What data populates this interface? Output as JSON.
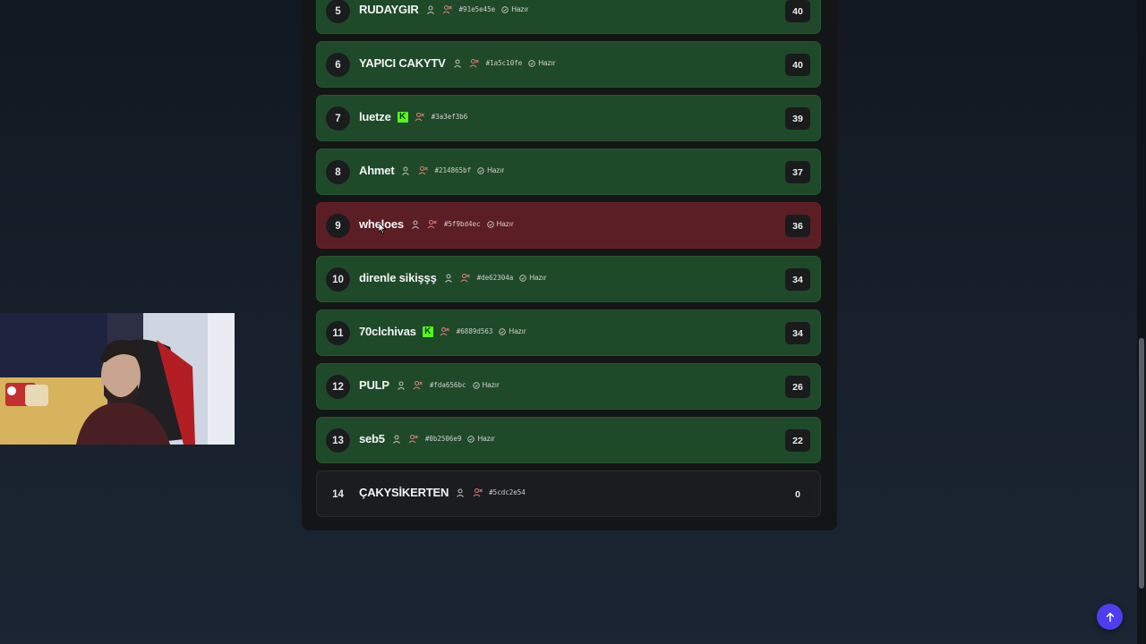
{
  "leaderboard": {
    "rows": [
      {
        "rank": "5",
        "name": "RUDAYGIR",
        "kick": false,
        "hash": "#91e5e45e",
        "status": "Hazır",
        "score": "40",
        "style": "green"
      },
      {
        "rank": "6",
        "name": "YAPICI CAKYTV",
        "kick": false,
        "hash": "#1a5c10fe",
        "status": "Hazır",
        "score": "40",
        "style": "green"
      },
      {
        "rank": "7",
        "name": "luetze",
        "kick": true,
        "hash": "#3a3ef3b6",
        "status": "",
        "score": "39",
        "style": "green"
      },
      {
        "rank": "8",
        "name": "Ahmet",
        "kick": false,
        "hash": "#214865bf",
        "status": "Hazır",
        "score": "37",
        "style": "green"
      },
      {
        "rank": "9",
        "name": "wheloes",
        "kick": false,
        "hash": "#5f9bd4ec",
        "status": "Hazır",
        "score": "36",
        "style": "red"
      },
      {
        "rank": "10",
        "name": "direnle sikişşş",
        "kick": false,
        "hash": "#de62304a",
        "status": "Hazır",
        "score": "34",
        "style": "green"
      },
      {
        "rank": "11",
        "name": "70clchivas",
        "kick": true,
        "hash": "#6889d563",
        "status": "Hazır",
        "score": "34",
        "style": "green"
      },
      {
        "rank": "12",
        "name": "PULP",
        "kick": false,
        "hash": "#fda656bc",
        "status": "Hazır",
        "score": "26",
        "style": "green"
      },
      {
        "rank": "13",
        "name": "seb5",
        "kick": false,
        "hash": "#0b2506e9",
        "status": "Hazır",
        "score": "22",
        "style": "green"
      },
      {
        "rank": "14",
        "name": "ÇAKYSİKERTEN",
        "kick": false,
        "hash": "#5cdc2e54",
        "status": "",
        "score": "0",
        "style": "dark"
      }
    ]
  },
  "icons": {
    "user": "user-icon",
    "user_remove": "user-remove-icon",
    "check": "check-circle-icon",
    "kick": "kick-badge-icon",
    "scroll_top": "arrow-up-icon"
  },
  "colors": {
    "row_green": "#1f4a29",
    "row_red": "#5a1e24",
    "row_dark": "#1b1c1e",
    "accent_button": "#4f3df0",
    "kick_green": "#53fc18"
  }
}
